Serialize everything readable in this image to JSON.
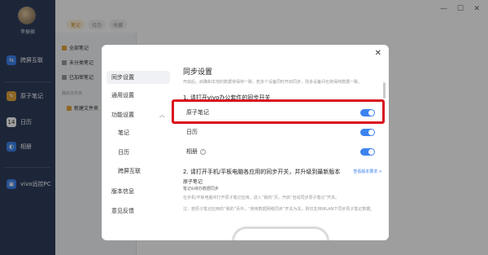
{
  "sidebar": {
    "username": "李振宿",
    "items": [
      {
        "label": "跨屏互联",
        "icon": "link-icon",
        "color": "#3d83f0"
      },
      {
        "label": "原子笔记",
        "icon": "note-icon",
        "color": "#e5a53a"
      },
      {
        "label": "日历",
        "icon": "calendar-icon",
        "color": "#ffffff"
      },
      {
        "label": "相册",
        "icon": "photo-icon",
        "color": "#3d83f0"
      },
      {
        "label": "vivo远控PC",
        "icon": "remote-icon",
        "color": "#3d83f0"
      }
    ]
  },
  "topbar": {
    "tabs": [
      {
        "label": "笔记"
      },
      {
        "label": "待办"
      },
      {
        "label": "收藏"
      }
    ],
    "window": {
      "minimize": "—",
      "maximize": "☐",
      "close": "✕"
    }
  },
  "notes_list": {
    "items": [
      {
        "label": "全部笔记"
      },
      {
        "label": "未分类笔记"
      },
      {
        "label": "已加密笔记"
      }
    ],
    "folder_header": "我的文件夹",
    "new_folder": "新建文件夹"
  },
  "dialog": {
    "title": "同步设置",
    "nav": [
      {
        "label": "同步设置"
      },
      {
        "label": "通用设置"
      },
      {
        "label": "功能设置"
      },
      {
        "label": "笔记"
      },
      {
        "label": "日历"
      },
      {
        "label": "跨屏互联"
      },
      {
        "label": "版本信息"
      },
      {
        "label": "意见反馈"
      }
    ],
    "description": "开启后，启确和本地的数据将保持一致，若多个设备同时开启同步，则多设备间也将保持数据一致。",
    "section1": "1. 请打开vivo办公套件的同步开关",
    "toggles": [
      {
        "label": "原子笔记",
        "on": true
      },
      {
        "label": "日历",
        "on": true
      },
      {
        "label": "相册",
        "on": true
      }
    ],
    "section2": "2. 请打开手机/平板电脑各应用的同步开关，并升级到最新版本",
    "version_link": "查看版本要求 >",
    "app_name": "原子笔记",
    "app_sub": "笔记&待办数据同步",
    "instruction1": "在手机/平板电脑中打开原子笔记应用，进入“我的”页，开启“自动同步原子笔记”开关。",
    "instruction2": "注：若原子笔记应用的“我的”页中，“使用数据网络同步”开关为关，则仅支持WLAN下同步原子笔记数据。",
    "close": "✕"
  },
  "colors": {
    "accent": "#3d83f0",
    "highlight": "#d9121e",
    "sidebar_bg": "#2f3e5c"
  }
}
